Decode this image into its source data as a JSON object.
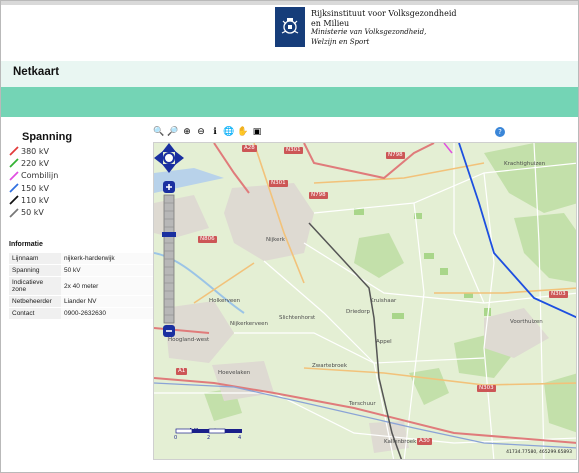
{
  "header": {
    "org_line1": "Rijksinstituut voor Volksgezondheid",
    "org_line2": "en Milieu",
    "ministry_line1": "Ministerie van Volksgezondheid,",
    "ministry_line2": "Welzijn en Sport"
  },
  "page_title": "Netkaart",
  "legend": {
    "title": "Spanning",
    "items": [
      {
        "label": "380 kV",
        "color": "#e23b3b"
      },
      {
        "label": "220 kV",
        "color": "#33b233"
      },
      {
        "label": "Combilijn",
        "color": "#e04fe0"
      },
      {
        "label": "150 kV",
        "color": "#2f6fe0"
      },
      {
        "label": "110 kV",
        "color": "#111111"
      },
      {
        "label": "50 kV",
        "color": "#777777"
      }
    ]
  },
  "info": {
    "title": "Informatie",
    "rows": [
      {
        "key": "Lijnnaam",
        "value": "nijkerk-harderwijk"
      },
      {
        "key": "Spanning",
        "value": "50 kV"
      },
      {
        "key": "Indicatieve zone",
        "value": "2x 40 meter"
      },
      {
        "key": "Netbeheerder",
        "value": "Liander NV"
      },
      {
        "key": "Contact",
        "value": "0900-2632630"
      }
    ]
  },
  "toolbar": {
    "tools": [
      {
        "icon": "zoom-box-icon",
        "glyph": "🔍"
      },
      {
        "icon": "zoom-extent-icon",
        "glyph": "🔎"
      },
      {
        "icon": "zoom-in-icon",
        "glyph": "⊕"
      },
      {
        "icon": "zoom-out-icon",
        "glyph": "⊖"
      },
      {
        "icon": "identify-icon",
        "glyph": "ℹ"
      },
      {
        "icon": "globe-icon",
        "glyph": "🌐"
      },
      {
        "icon": "pan-hand-icon",
        "glyph": "✋"
      },
      {
        "icon": "print-icon",
        "glyph": "▣"
      }
    ],
    "help": "?"
  },
  "map": {
    "place_labels": [
      "Nijkerk",
      "Slichtenhorst",
      "Driedorp",
      "Kruishaar",
      "Appel",
      "Holkerveen",
      "Nijkerkerveen",
      "Hoogland-west",
      "Hoevelaken",
      "Zwartebroek",
      "Terschuur",
      "Voorthuizen",
      "Krachtighuizen",
      "Kallenbroek"
    ],
    "road_labels": [
      "N301",
      "N798",
      "N798",
      "A28",
      "N806",
      "N301",
      "N303",
      "A1",
      "A30",
      "N303"
    ],
    "coordinates": "41734.77580, 465299.65893",
    "scale_title": "kilometers",
    "scale_ticks": [
      "0",
      "2",
      "4"
    ]
  }
}
